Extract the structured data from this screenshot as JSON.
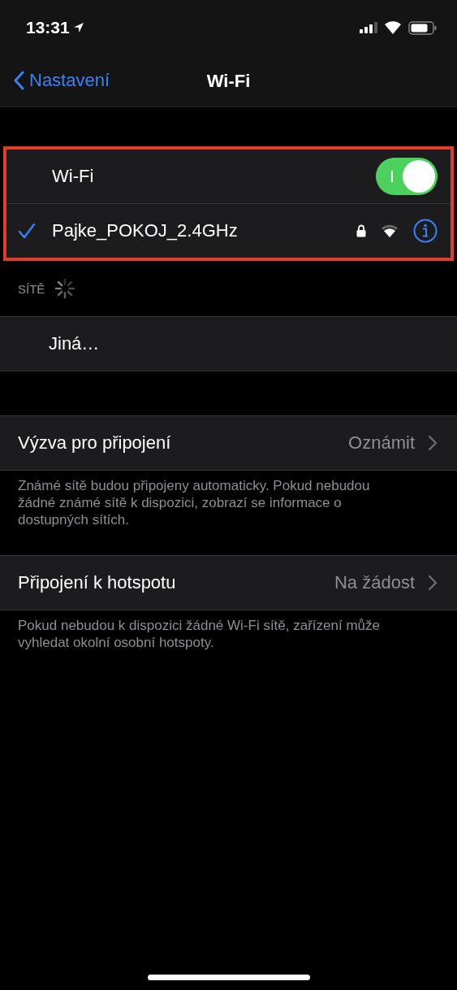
{
  "status_bar": {
    "time": "13:31"
  },
  "nav": {
    "back": "Nastavení",
    "title": "Wi-Fi"
  },
  "wifi_group": {
    "highlighted": true,
    "label": "Wi-Fi",
    "on": true,
    "network": {
      "name": "Pajke_POKOJ_2.4GHz",
      "selected": true,
      "locked": true
    }
  },
  "networks": {
    "header": "SÍTĚ",
    "other": "Jiná…"
  },
  "settings": [
    {
      "label": "Výzva pro připojení",
      "value": "Oznámit",
      "footer": "Známé sítě budou připojeny automaticky. Pokud nebudou žádné známé sítě k dispozici, zobrazí se informace o dostupných sítích."
    },
    {
      "label": "Připojení k hotspotu",
      "value": "Na žádost",
      "footer": "Pokud nebudou k dispozici žádné Wi-Fi sítě, zařízení může vyhledat okolní osobní hotspoty."
    }
  ]
}
